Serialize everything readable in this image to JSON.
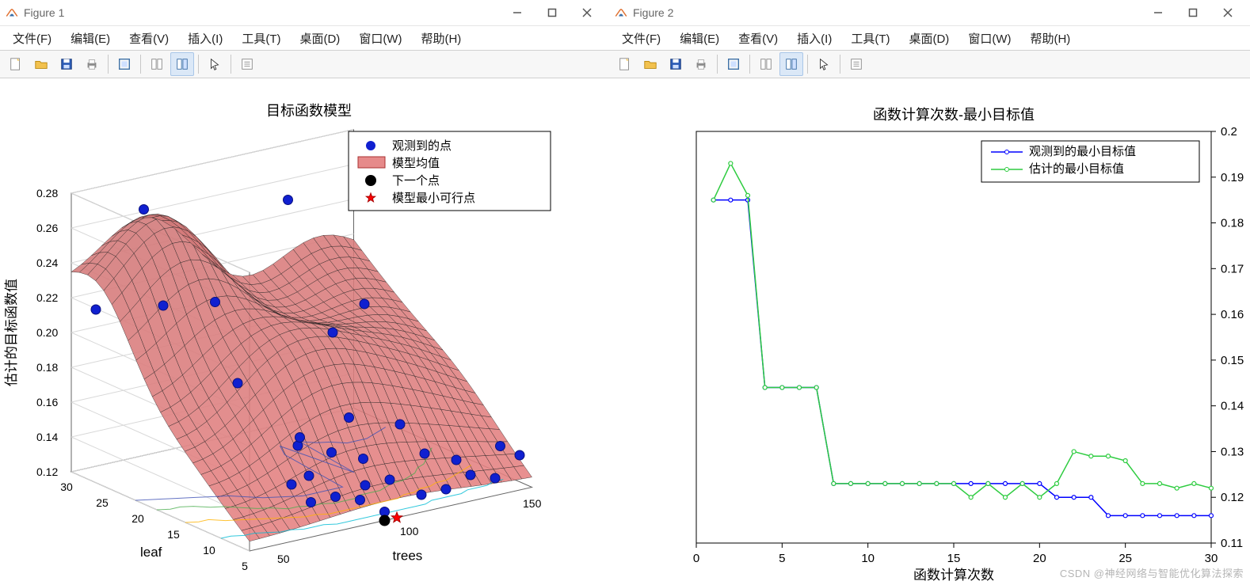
{
  "window1": {
    "title": "Figure 1",
    "menus": [
      "文件(F)",
      "编辑(E)",
      "查看(V)",
      "插入(I)",
      "工具(T)",
      "桌面(D)",
      "窗口(W)",
      "帮助(H)"
    ]
  },
  "window2": {
    "title": "Figure 2",
    "menus": [
      "文件(F)",
      "编辑(E)",
      "查看(V)",
      "插入(I)",
      "工具(T)",
      "桌面(D)",
      "窗口(W)",
      "帮助(H)"
    ]
  },
  "toolbar_icons": [
    "new",
    "open",
    "save",
    "print",
    "figure",
    "show-tools",
    "linked-selection",
    "cursor",
    "insert"
  ],
  "chart1": {
    "title": "目标函数模型",
    "zlabel": "估计的目标函数值",
    "xlabel": "leaf",
    "ylabel": "trees",
    "legend": [
      "观测到的点",
      "模型均值",
      "下一个点",
      "模型最小可行点"
    ],
    "x_ticks": [
      30,
      25,
      20,
      15,
      10,
      5
    ],
    "y_ticks": [
      50,
      100,
      150
    ],
    "z_ticks": [
      0.12,
      0.14,
      0.16,
      0.18,
      0.2,
      0.22,
      0.24,
      0.26,
      0.28
    ]
  },
  "chart2": {
    "title": "函数计算次数-最小目标值",
    "xlabel": "函数计算次数",
    "legend": [
      "观测到的最小目标值",
      "估计的最小目标值"
    ],
    "x_ticks": [
      0,
      5,
      10,
      15,
      20,
      25,
      30
    ],
    "y_ticks": [
      0.11,
      0.12,
      0.13,
      0.14,
      0.15,
      0.16,
      0.17,
      0.18,
      0.19,
      0.2
    ]
  },
  "chart_data": [
    {
      "type": "area",
      "note": "3D surface model; z interpreted visually at sample points",
      "title": "目标函数模型",
      "xlabel": "leaf",
      "ylabel": "trees",
      "zlabel": "估计的目标函数值",
      "xlim": [
        5,
        30
      ],
      "ylim": [
        50,
        150
      ],
      "zlim": [
        0.12,
        0.28
      ],
      "observed_points": [
        {
          "leaf": 30,
          "trees": 50,
          "z": 0.21
        },
        {
          "leaf": 25,
          "trees": 55,
          "z": 0.275
        },
        {
          "leaf": 22,
          "trees": 105,
          "z": 0.27
        },
        {
          "leaf": 24,
          "trees": 60,
          "z": 0.22
        },
        {
          "leaf": 15,
          "trees": 55,
          "z": 0.24
        },
        {
          "leaf": 17,
          "trees": 70,
          "z": 0.185
        },
        {
          "leaf": 14,
          "trees": 100,
          "z": 0.21
        },
        {
          "leaf": 13,
          "trees": 110,
          "z": 0.225
        },
        {
          "leaf": 12,
          "trees": 80,
          "z": 0.155
        },
        {
          "leaf": 10,
          "trees": 75,
          "z": 0.165
        },
        {
          "leaf": 10,
          "trees": 95,
          "z": 0.17
        },
        {
          "leaf": 9,
          "trees": 85,
          "z": 0.155
        },
        {
          "leaf": 8,
          "trees": 110,
          "z": 0.165
        },
        {
          "leaf": 8,
          "trees": 95,
          "z": 0.15
        },
        {
          "leaf": 8,
          "trees": 120,
          "z": 0.145
        },
        {
          "leaf": 7,
          "trees": 70,
          "z": 0.15
        },
        {
          "leaf": 7,
          "trees": 130,
          "z": 0.14
        },
        {
          "leaf": 6,
          "trees": 90,
          "z": 0.14
        },
        {
          "leaf": 6,
          "trees": 145,
          "z": 0.145
        },
        {
          "leaf": 6,
          "trees": 100,
          "z": 0.14
        },
        {
          "leaf": 5,
          "trees": 85,
          "z": 0.135
        },
        {
          "leaf": 5,
          "trees": 95,
          "z": 0.125
        },
        {
          "leaf": 5,
          "trees": 120,
          "z": 0.13
        },
        {
          "leaf": 5,
          "trees": 130,
          "z": 0.135
        },
        {
          "leaf": 5,
          "trees": 110,
          "z": 0.13
        },
        {
          "leaf": 5,
          "trees": 140,
          "z": 0.13
        },
        {
          "leaf": 5,
          "trees": 150,
          "z": 0.14
        },
        {
          "leaf": 5,
          "trees": 75,
          "z": 0.14
        },
        {
          "leaf": 5,
          "trees": 65,
          "z": 0.14
        },
        {
          "leaf": 6,
          "trees": 60,
          "z": 0.15
        }
      ],
      "next_point": {
        "leaf": 5,
        "trees": 95,
        "z": 0.12
      },
      "min_feasible_point": {
        "leaf": 5,
        "trees": 100,
        "z": 0.12
      }
    },
    {
      "type": "line",
      "title": "函数计算次数-最小目标值",
      "xlabel": "函数计算次数",
      "ylabel": "",
      "xlim": [
        0,
        30
      ],
      "ylim": [
        0.11,
        0.2
      ],
      "x": [
        1,
        2,
        3,
        4,
        5,
        6,
        7,
        8,
        9,
        10,
        11,
        12,
        13,
        14,
        15,
        16,
        17,
        18,
        19,
        20,
        21,
        22,
        23,
        24,
        25,
        26,
        27,
        28,
        29,
        30
      ],
      "series": [
        {
          "name": "观测到的最小目标值",
          "color": "#0000ff",
          "values": [
            0.185,
            0.185,
            0.185,
            0.144,
            0.144,
            0.144,
            0.144,
            0.123,
            0.123,
            0.123,
            0.123,
            0.123,
            0.123,
            0.123,
            0.123,
            0.123,
            0.123,
            0.123,
            0.123,
            0.123,
            0.12,
            0.12,
            0.12,
            0.116,
            0.116,
            0.116,
            0.116,
            0.116,
            0.116,
            0.116
          ]
        },
        {
          "name": "估计的最小目标值",
          "color": "#2ecc40",
          "values": [
            0.185,
            0.193,
            0.186,
            0.144,
            0.144,
            0.144,
            0.144,
            0.123,
            0.123,
            0.123,
            0.123,
            0.123,
            0.123,
            0.123,
            0.123,
            0.12,
            0.123,
            0.12,
            0.123,
            0.12,
            0.123,
            0.13,
            0.129,
            0.129,
            0.128,
            0.123,
            0.123,
            0.122,
            0.123,
            0.122
          ]
        }
      ]
    }
  ],
  "watermark": "CSDN @神经网络与智能优化算法探索"
}
